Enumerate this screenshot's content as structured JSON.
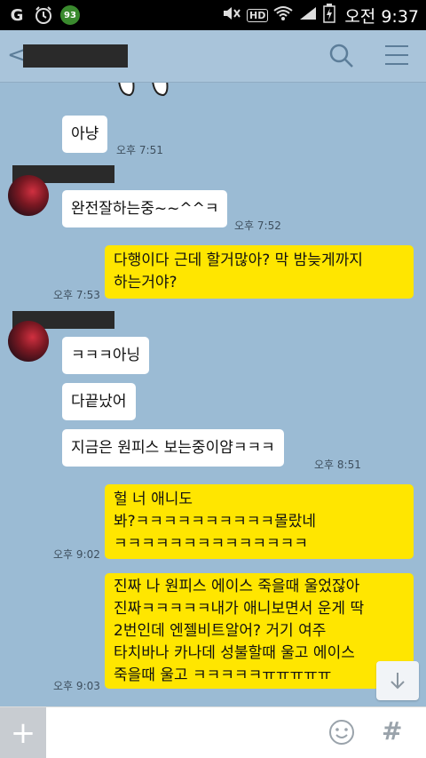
{
  "status_bar": {
    "time": "오전 9:37",
    "hd": "HD",
    "badge_count": "93",
    "carrier_logo": "G"
  },
  "header": {
    "back_icon": "<",
    "title": ""
  },
  "messages": [
    {
      "id": "m1",
      "side": "in",
      "text": "아냥",
      "time": "오후 7:51"
    },
    {
      "id": "m2",
      "side": "in",
      "text": "완전잘하는중~~^^ㅋ",
      "time": "오후 7:52"
    },
    {
      "id": "m3",
      "side": "out",
      "text": "다행이다 근데 할거많아? 막 밤늦게까지\n하는거야?",
      "time": "오후 7:53"
    },
    {
      "id": "m4",
      "side": "in",
      "text": "ㅋㅋㅋ아닝",
      "time": ""
    },
    {
      "id": "m5",
      "side": "in",
      "text": "다끝났어",
      "time": ""
    },
    {
      "id": "m6",
      "side": "in",
      "text": "지금은 원피스 보는중이얌ㅋㅋㅋ",
      "time": "오후 8:51"
    },
    {
      "id": "m7",
      "side": "out",
      "text": "헐 너 애니도\n봐?ㅋㅋㅋㅋㅋㅋㅋㅋㅋㅋ몰랐네\nㅋㅋㅋㅋㅋㅋㅋㅋㅋㅋㅋㅋㅋㅋ",
      "time": "오후 9:02"
    },
    {
      "id": "m8",
      "side": "out",
      "text": "진짜 나 원피스 에이스 죽을때 울었잖아\n진짜ㅋㅋㅋㅋㅋ내가 애니보면서 운게 딱\n2번인데 엔젤비트알어? 거기 여주\n타치바나 카나데 성불할때 울고 에이스\n죽을때 울고 ㅋㅋㅋㅋㅋㅠㅠㅠㅠㅠ",
      "time": "오후 9:03"
    }
  ],
  "input_bar": {
    "plus": "+",
    "placeholder": "",
    "hash": "#"
  },
  "colors": {
    "chat_bg": "#9bbbd4",
    "out_bubble": "#ffe600",
    "in_bubble": "#ffffff",
    "header_bg": "#a9c4da"
  }
}
